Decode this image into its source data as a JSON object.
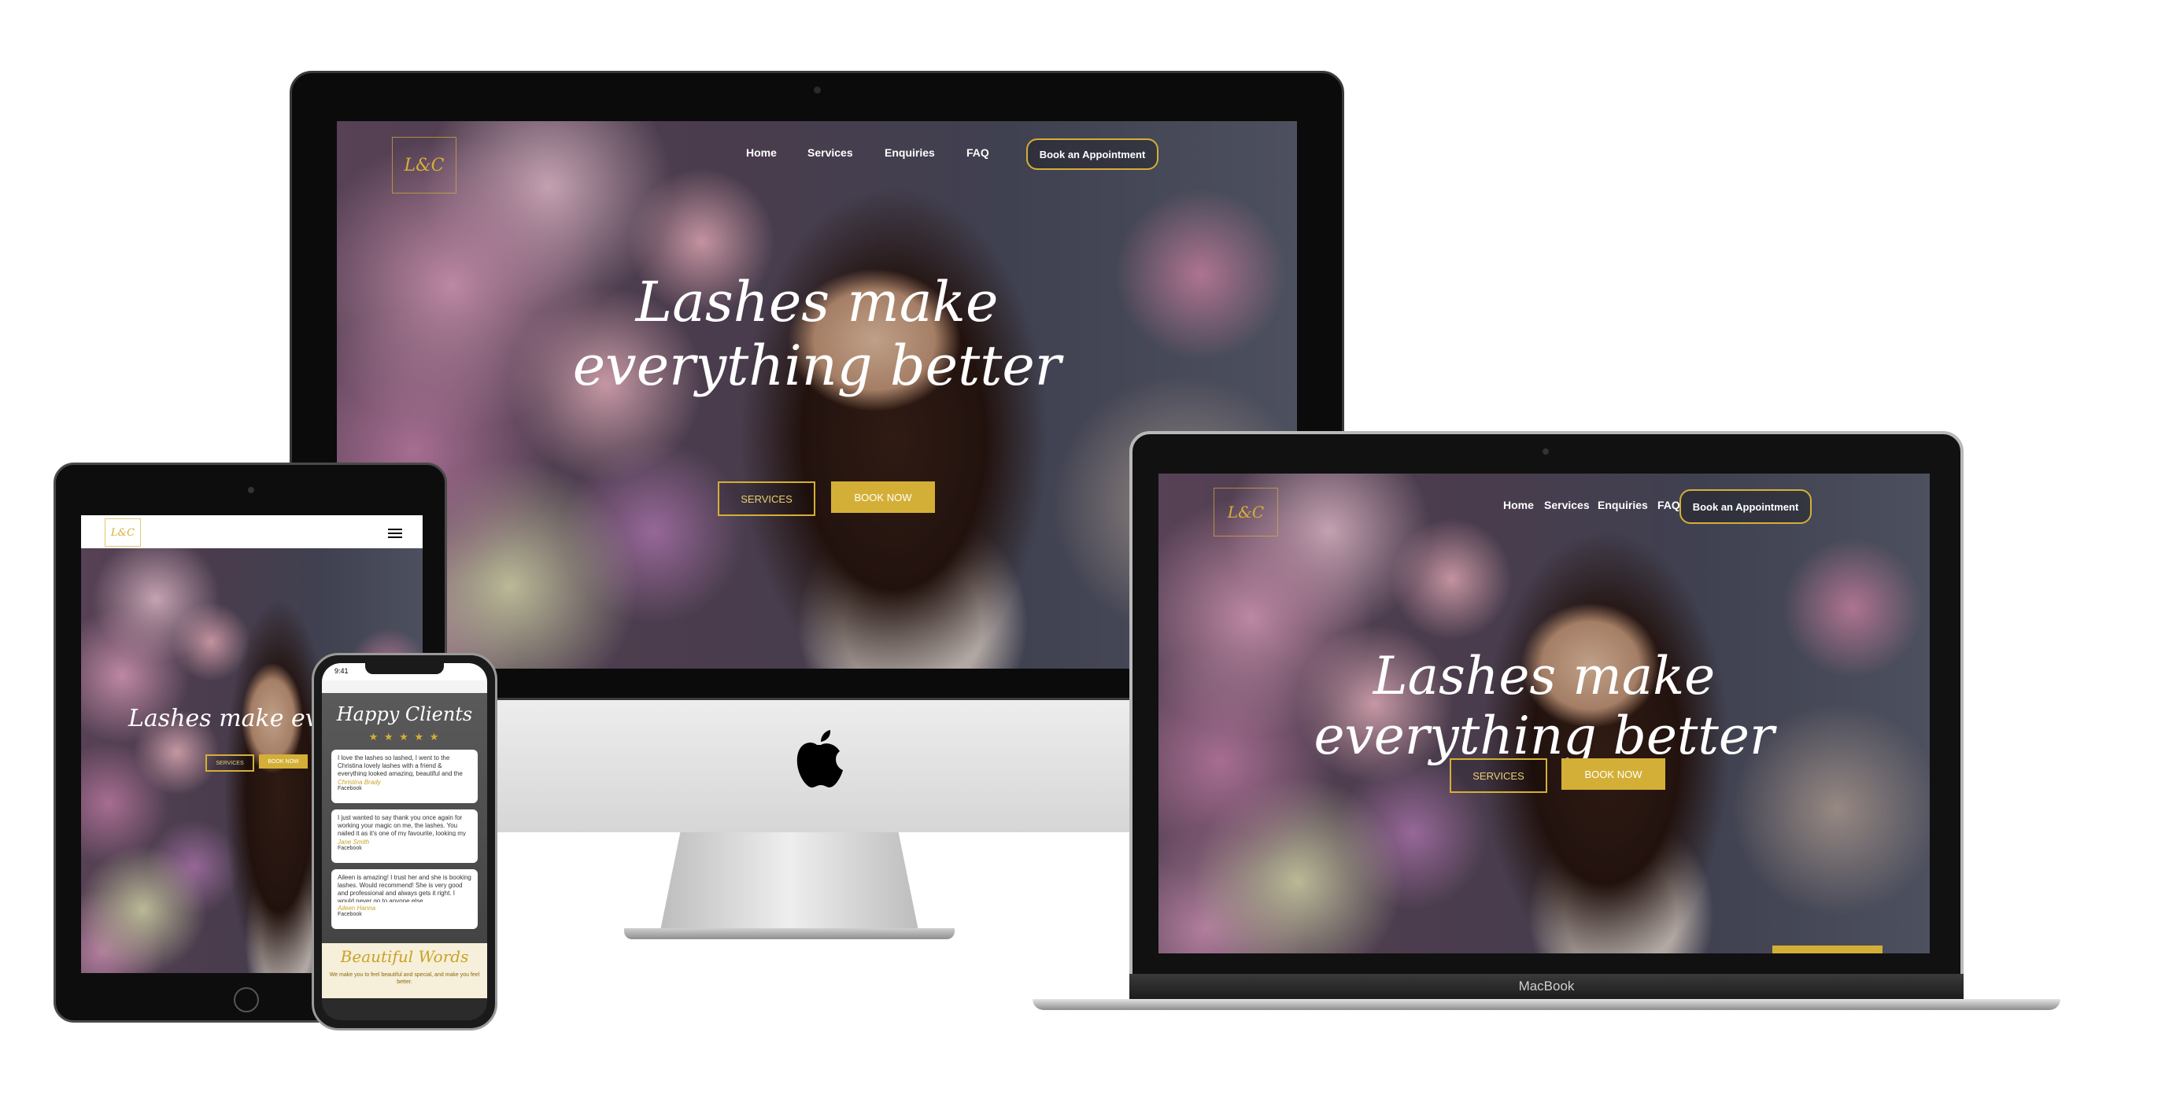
{
  "brand": {
    "logo_text": "L&C",
    "gold": "#d4af37"
  },
  "nav": {
    "items": [
      "Home",
      "Services",
      "Enquiries",
      "FAQ"
    ],
    "cta": "Book an Appointment"
  },
  "hero": {
    "headline": "Lashes make everything better",
    "btn_services": "SERVICES",
    "btn_book": "BOOK NOW"
  },
  "tablet": {
    "headline": "Lashes make everythi",
    "btn_services": "SERVICES",
    "btn_book": "BOOK NOW",
    "menu_icon": "hamburger-icon"
  },
  "phone": {
    "status_time": "9:41",
    "section_title": "Happy Clients",
    "stars": "★ ★ ★ ★ ★",
    "testimonials": [
      {
        "text": "I love the lashes so lashed, I went to the Christina lovely lashes with a friend & everything looked amazing, beautiful and the detail in lashes",
        "author": "Christina Brady",
        "source": "Facebook"
      },
      {
        "text": "I just wanted to say thank you once again for working your magic on me, the lashes. You nailed it as it's one of my favourite, looking my lashes. Thank you",
        "author": "Jane Smith",
        "source": "Facebook"
      },
      {
        "text": "Aileen is amazing! I trust her and she is booking lashes. Would recommend! She is very good and professional and always gets it right. I would never go to anyone else",
        "author": "Aileen Hanna",
        "source": "Facebook"
      }
    ],
    "footer_script": "Beautiful Words",
    "footer_text": "We make you to feel beautiful and special, and make you feel better."
  },
  "laptop": {
    "label": "MacBook"
  },
  "icons": [
    "apple-logo-icon",
    "camera-icon",
    "home-button-icon",
    "hamburger-icon",
    "star-icon"
  ]
}
